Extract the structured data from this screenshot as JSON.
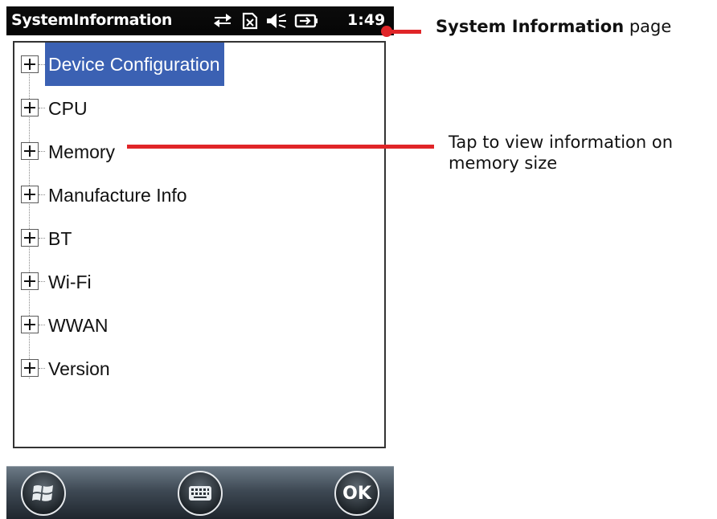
{
  "statusbar": {
    "app_title": "SystemInformation",
    "time": "1:49",
    "icons": [
      "sync-arrows-icon",
      "no-sim-icon",
      "speaker-muted-icon",
      "battery-charging-icon"
    ]
  },
  "tree": {
    "items": [
      {
        "label": "Device Configuration",
        "selected": true
      },
      {
        "label": "CPU"
      },
      {
        "label": "Memory"
      },
      {
        "label": "Manufacture Info"
      },
      {
        "label": "BT"
      },
      {
        "label": "Wi-Fi"
      },
      {
        "label": "WWAN"
      },
      {
        "label": "Version"
      }
    ],
    "selection_color": "#3b61b3"
  },
  "softbar": {
    "left_icon": "windows-start-icon",
    "center_icon": "keyboard-icon",
    "right_label": "OK"
  },
  "annotations": {
    "page_title_bold": "System Information",
    "page_title_rest": " page",
    "memory_line1": "Tap to view information on",
    "memory_line2": "memory size",
    "accent_color": "#e02528"
  }
}
